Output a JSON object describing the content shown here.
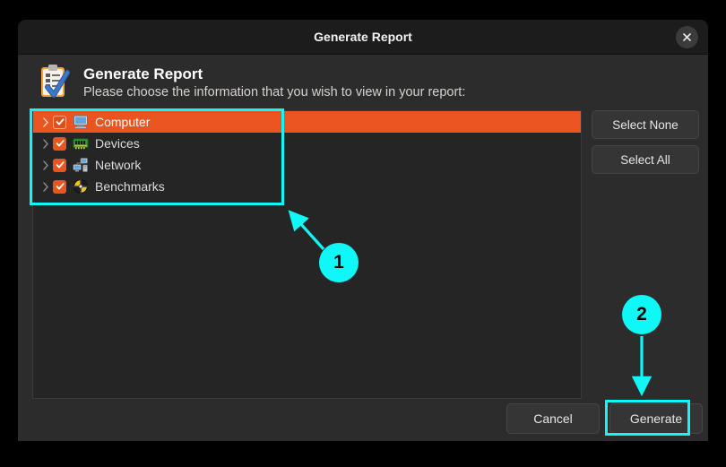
{
  "window": {
    "title": "Generate Report",
    "close_icon": "close-icon"
  },
  "header": {
    "icon": "clipboard-check-icon",
    "title": "Generate Report",
    "subtitle": "Please choose the information that you wish to view in your report:"
  },
  "list": {
    "items": [
      {
        "label": "Computer",
        "icon": "monitor-icon",
        "checked": true,
        "selected": true,
        "expand_icon": "chevron-right-icon"
      },
      {
        "label": "Devices",
        "icon": "circuit-board-icon",
        "checked": true,
        "selected": false,
        "expand_icon": "chevron-right-icon"
      },
      {
        "label": "Network",
        "icon": "network-computers-icon",
        "checked": true,
        "selected": false,
        "expand_icon": "chevron-right-icon"
      },
      {
        "label": "Benchmarks",
        "icon": "benchmark-target-icon",
        "checked": true,
        "selected": false,
        "expand_icon": "chevron-right-icon"
      }
    ]
  },
  "side_buttons": {
    "select_none": "Select None",
    "select_all": "Select All"
  },
  "bottom_buttons": {
    "cancel": "Cancel",
    "generate": "Generate"
  },
  "annotations": {
    "badge_1": "1",
    "badge_2": "2"
  },
  "colors": {
    "accent_orange": "#e95420",
    "annotation_cyan": "#0ff7f7",
    "dialog_bg": "#2c2c2c",
    "titlebar_bg": "#1c1c1c",
    "list_bg": "#252525"
  }
}
